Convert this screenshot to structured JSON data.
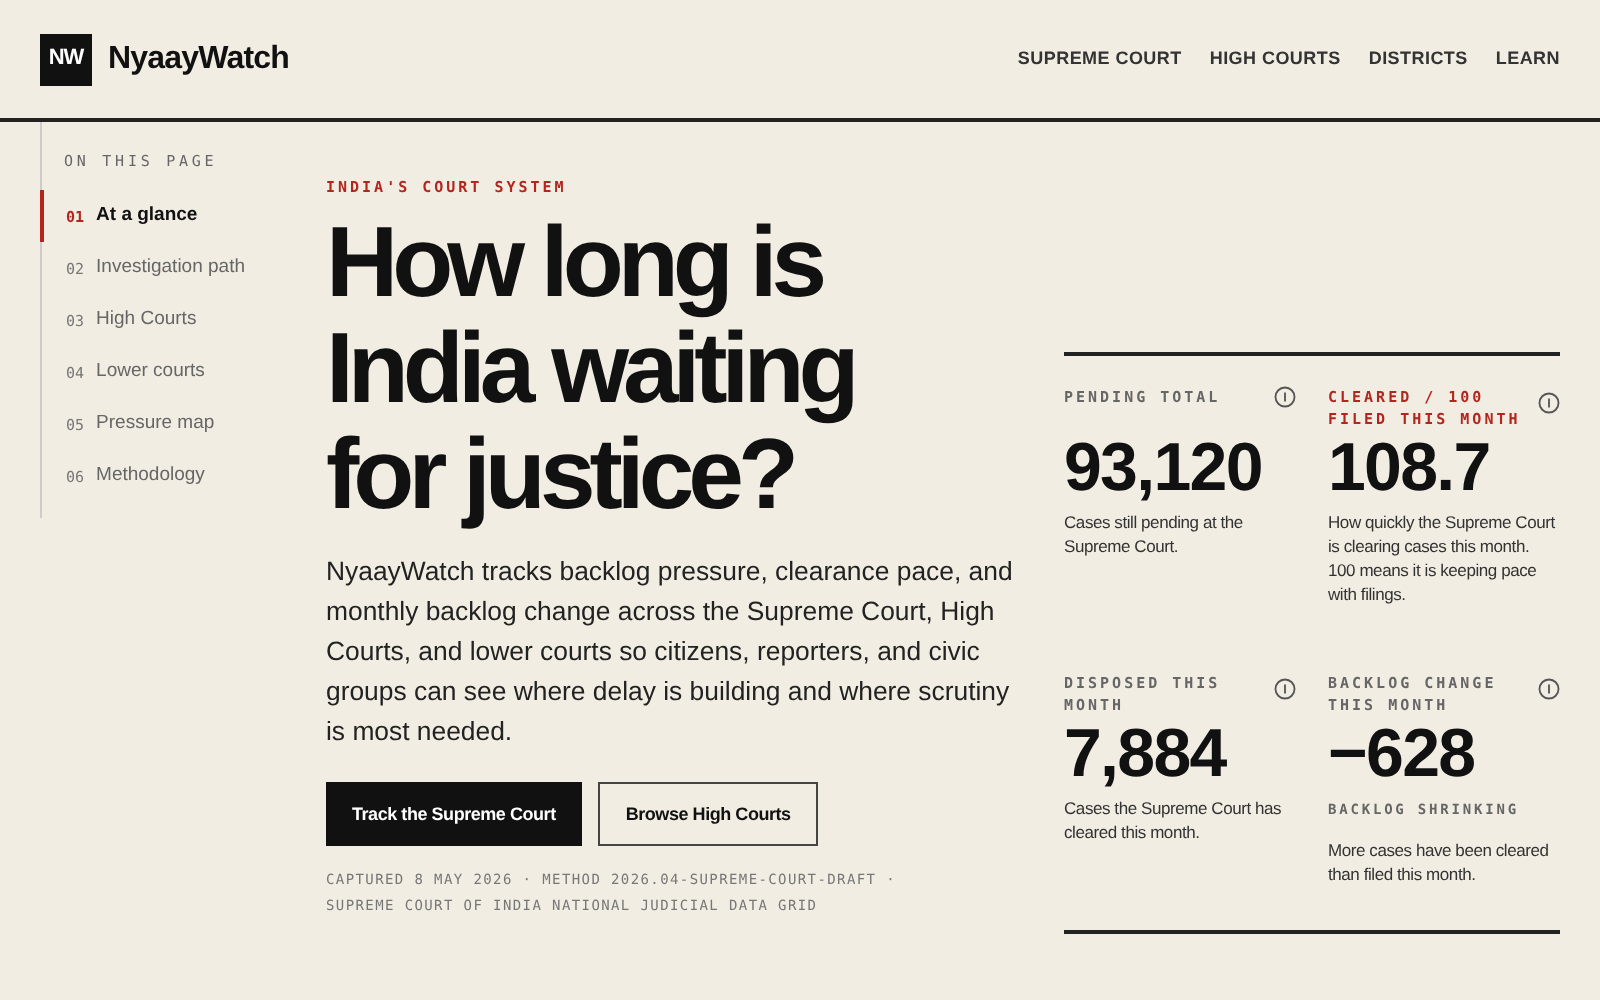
{
  "brand": {
    "logo": "NW",
    "name": "NyaayWatch"
  },
  "nav": [
    "SUPREME COURT",
    "HIGH COURTS",
    "DISTRICTS",
    "LEARN"
  ],
  "toc": {
    "heading": "ON THIS PAGE",
    "items": [
      {
        "num": "01",
        "label": "At a glance",
        "selected": true
      },
      {
        "num": "02",
        "label": "Investigation path",
        "selected": false
      },
      {
        "num": "03",
        "label": "High Courts",
        "selected": false
      },
      {
        "num": "04",
        "label": "Lower courts",
        "selected": false
      },
      {
        "num": "05",
        "label": "Pressure map",
        "selected": false
      },
      {
        "num": "06",
        "label": "Methodology",
        "selected": false
      }
    ]
  },
  "hero": {
    "eyebrow": "INDIA'S COURT SYSTEM",
    "title_lines": [
      "How long is",
      "India waiting",
      "for justice?"
    ],
    "body": "NyaayWatch tracks backlog pressure, clearance pace, and monthly backlog change across the Supreme Court, High Courts, and lower courts so citizens, reporters, and civic groups can see where delay is building and where scrutiny is most needed.",
    "buttons": [
      {
        "label": "Track the Supreme Court",
        "kind": "primary"
      },
      {
        "label": "Browse High Courts",
        "kind": "secondary"
      }
    ],
    "meta_lines": [
      "CAPTURED 8 MAY 2026 · METHOD 2026.04-SUPREME-COURT-DRAFT ·",
      "SUPREME COURT OF INDIA NATIONAL JUDICIAL DATA GRID"
    ]
  },
  "stats": [
    {
      "label": "PENDING TOTAL",
      "highlight": false,
      "value": "93,120",
      "description": "Cases still pending at the Supreme Court."
    },
    {
      "label": "CLEARED / 100 FILED THIS MONTH",
      "highlight": true,
      "value": "108.7",
      "description": "How quickly the Supreme Court is clearing cases this month. 100 means it is keeping pace with filings."
    },
    {
      "label": "DISPOSED THIS MONTH",
      "highlight": false,
      "value": "7,884",
      "description": "Cases the Supreme Court has cleared this month."
    },
    {
      "label": "BACKLOG CHANGE THIS MONTH",
      "highlight": false,
      "value": "−628",
      "note": "BACKLOG SHRINKING",
      "description": "More cases have been cleared than filed this month."
    }
  ]
}
